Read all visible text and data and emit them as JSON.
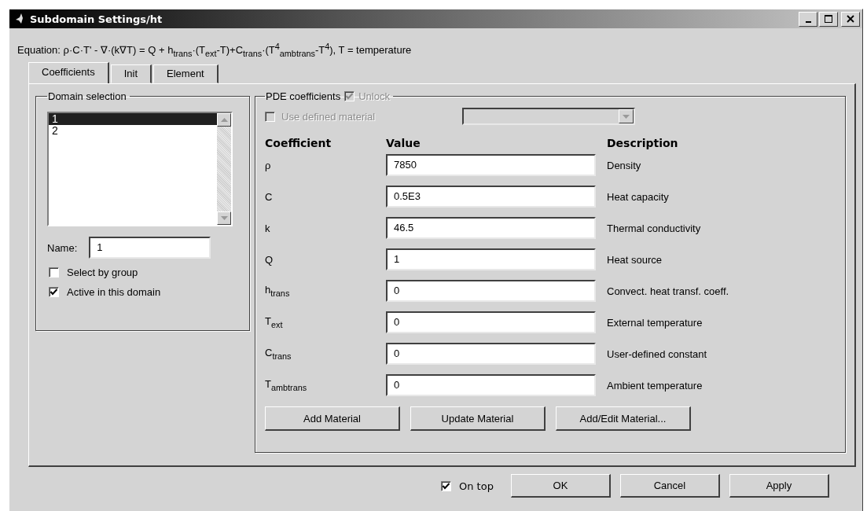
{
  "window": {
    "title": "Subdomain Settings/ht"
  },
  "equation": "Equation: ρ·C·T' - ∇·(k∇T) = Q + h$_{trans}$·(T$_{ext}$-T)+C$_{trans}$·(T$^{4}$$_{ambtrans}$-T$^{4}$), T = temperature",
  "tabs": [
    {
      "label": "Coefficients",
      "selected": true
    },
    {
      "label": "Init",
      "selected": false
    },
    {
      "label": "Element",
      "selected": false
    }
  ],
  "domain_selection": {
    "title": "Domain selection",
    "items": [
      {
        "label": "1",
        "selected": true
      },
      {
        "label": "2",
        "selected": false
      }
    ],
    "name_label": "Name:",
    "name_value": "1",
    "checkboxes": [
      {
        "label": "Select by group",
        "checked": false
      },
      {
        "label": "Active in this domain",
        "checked": true
      }
    ]
  },
  "pde": {
    "title": "PDE coefficients",
    "unlock": {
      "label": "Unlock",
      "checked": true,
      "disabled": true
    },
    "use_material": {
      "label": "Use defined material",
      "checked": false,
      "disabled": true
    },
    "headers": [
      "Coefficient",
      "Value",
      "Description"
    ],
    "rows": [
      {
        "symbol": "ρ",
        "value": "7850",
        "description": "Density"
      },
      {
        "symbol": "C",
        "value": "0.5E3",
        "description": "Heat capacity"
      },
      {
        "symbol": "k",
        "value": "46.5",
        "description": "Thermal conductivity"
      },
      {
        "symbol": "Q",
        "value": "1",
        "description": "Heat source"
      },
      {
        "symbol": "h$_{trans}$",
        "value": "0",
        "description": "Convect. heat transf. coeff."
      },
      {
        "symbol": "T$_{ext}$",
        "value": "0",
        "description": "External temperature"
      },
      {
        "symbol": "C$_{trans}$",
        "value": "0",
        "description": "User-defined constant"
      },
      {
        "symbol": "T$_{ambtrans}$",
        "value": "0",
        "description": "Ambient temperature"
      }
    ],
    "buttons": [
      "Add Material",
      "Update Material",
      "Add/Edit Material..."
    ]
  },
  "footer": {
    "on_top": {
      "label": "On top",
      "checked": true
    },
    "buttons": [
      "OK",
      "Cancel",
      "Apply"
    ]
  }
}
